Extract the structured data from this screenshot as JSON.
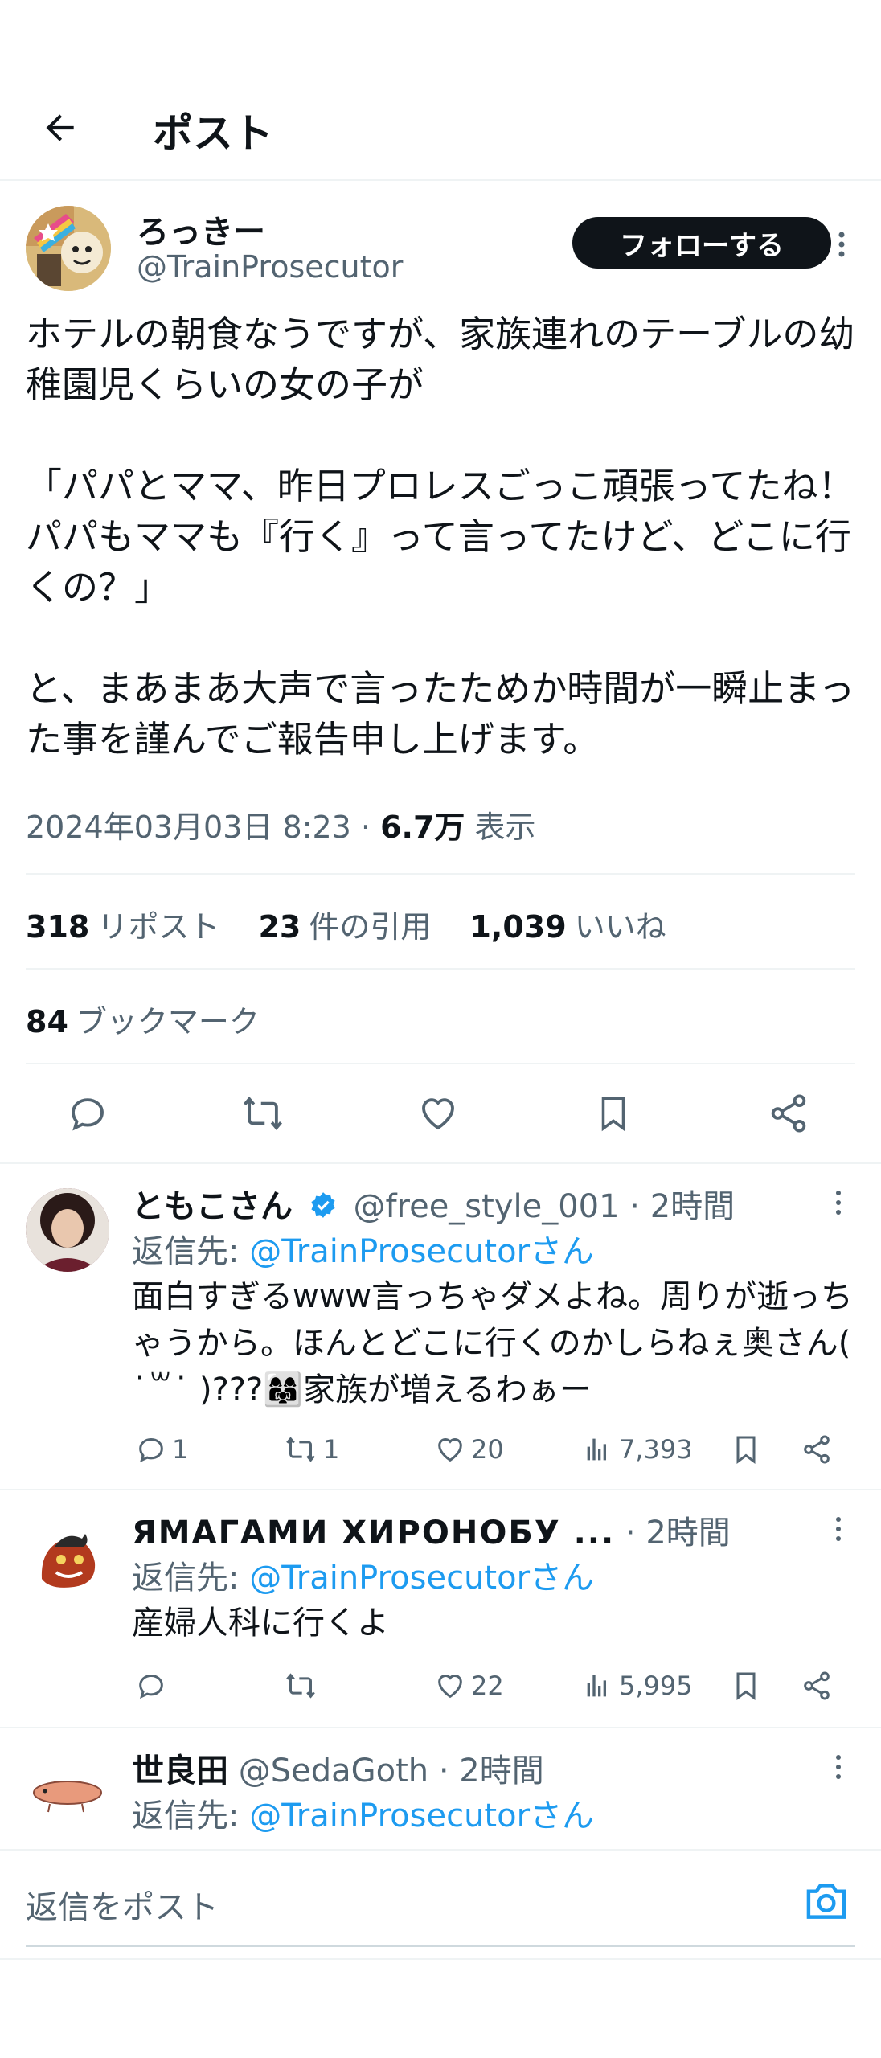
{
  "header": {
    "title": "ポスト"
  },
  "post": {
    "author_name": "ろっきー",
    "author_handle": "@TrainProsecutor",
    "follow_label": "フォローする",
    "text": "ホテルの朝食なうですが、家族連れのテーブルの幼稚園児くらいの女の子が\n\n「パパとママ、昨日プロレスごっこ頑張ってたね！パパもママも『行く』って言ってたけど、どこに行くの？」\n\nと、まあまあ大声で言ったためか時間が一瞬止まった事を謹んでご報告申し上げます。",
    "timestamp": "2024年03月03日 8:23",
    "separator": "·",
    "views_count": "6.7万",
    "views_label": "表示",
    "reposts_count": "318",
    "reposts_label": "リポスト",
    "quotes_count": "23",
    "quotes_label": "件の引用",
    "likes_count": "1,039",
    "likes_label": "いいね",
    "bookmarks_count": "84",
    "bookmarks_label": "ブックマーク"
  },
  "replies": [
    {
      "name": "ともこさん",
      "verified": true,
      "handle": "@free_style_001",
      "time": "· 2時間",
      "reply_prefix": "返信先: ",
      "reply_to": "@TrainProsecutorさん",
      "text": "面白すぎるwww言っちゃダメよね。周りが逝っちゃうから。ほんとどこに行くのかしらねぇ奥さん( ˙꒳˙ )???👩‍👩‍👧家族が増えるわぁー",
      "replies": "1",
      "reposts": "1",
      "likes": "20",
      "views": "7,393"
    },
    {
      "name": "ЯМАГАМИ ХИРОНОБУ ...",
      "verified": false,
      "handle": "",
      "time": "· 2時間",
      "reply_prefix": "返信先: ",
      "reply_to": "@TrainProsecutorさん",
      "text": "産婦人科に行くよ",
      "replies": "",
      "reposts": "",
      "likes": "22",
      "views": "5,995"
    },
    {
      "name": "世良田",
      "verified": false,
      "handle": "@SedaGoth",
      "time": "· 2時間",
      "reply_prefix": "返信先: ",
      "reply_to": "@TrainProsecutorさん"
    }
  ],
  "composer": {
    "placeholder": "返信をポスト"
  },
  "colors": {
    "accent": "#1d9bf0",
    "text": "#0f1419",
    "secondary": "#536471"
  }
}
